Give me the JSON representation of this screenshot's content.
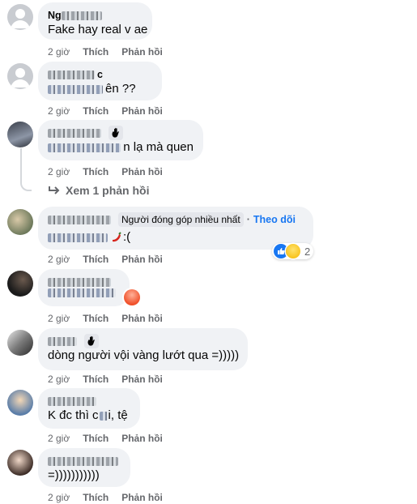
{
  "action_labels": {
    "time": "2 giờ",
    "like": "Thích",
    "reply": "Phản hồi"
  },
  "comments": [
    {
      "id": 1,
      "name_visible": "Ng",
      "text": "Fake hay real v ae"
    },
    {
      "id": 2,
      "name_visible": "c",
      "text_visible": "ên ??"
    },
    {
      "id": 3,
      "text_visible": "n lạ mà quen",
      "has_wave_badge": true
    },
    {
      "id": 4,
      "contributor_badge": "Người đóng góp nhiều nhất",
      "follow_label": "Theo dõi",
      "text_visible": ":(",
      "reaction_count": "2"
    },
    {
      "id": 5,
      "has_angry_reaction": true
    },
    {
      "id": 6,
      "text": "dòng người vội vàng lướt qua =)))))",
      "has_wave_badge": true
    },
    {
      "id": 7,
      "text_prefix": "K đc thì c",
      "text_suffix": "i, tệ"
    },
    {
      "id": 8,
      "text": "=)))))))))))"
    }
  ],
  "view_replies_label": "Xem 1 phản hồi",
  "icons": [
    "default-avatar-icon",
    "wave-hand-icon",
    "reply-arrow-icon",
    "chili-emoji-icon",
    "angry-reaction-icon",
    "like-reaction-icon",
    "sad-reaction-icon"
  ],
  "colors": {
    "bubble": "#f0f2f5",
    "link": "#1877f2",
    "meta": "#65676b"
  }
}
